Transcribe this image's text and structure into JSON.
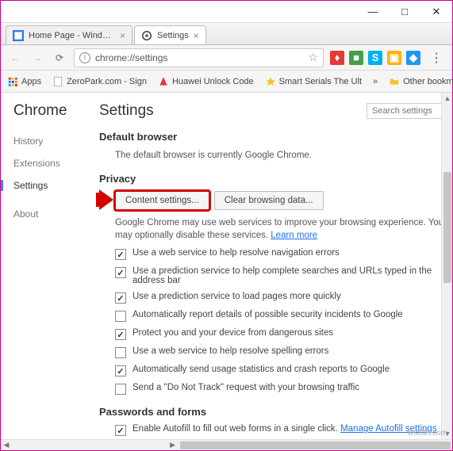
{
  "window": {
    "minimize": "—",
    "maximize": "□",
    "close": "✕"
  },
  "tabs": [
    {
      "label": "Home Page - Windows T",
      "close": "×"
    },
    {
      "label": "Settings",
      "close": "×"
    }
  ],
  "address": {
    "url": "chrome://settings"
  },
  "extensions": [
    "A",
    "B",
    "S",
    "P",
    "E"
  ],
  "bookmarks": {
    "apps": "Apps",
    "zeropark": "ZeroPark.com - Sign",
    "huawei": "Huawei Unlock Code",
    "serials": "Smart Serials The Ult",
    "other": "Other bookmarks"
  },
  "leftnav": {
    "title": "Chrome",
    "history": "History",
    "extensions": "Extensions",
    "settings": "Settings",
    "about": "About"
  },
  "page": {
    "title": "Settings",
    "search_placeholder": "Search settings"
  },
  "default_browser": {
    "heading": "Default browser",
    "text": "The default browser is currently Google Chrome."
  },
  "privacy": {
    "heading": "Privacy",
    "content_btn": "Content settings...",
    "clear_btn": "Clear browsing data...",
    "desc_pre": "Google Chrome may use web services to improve your browsing experience. You may optionally disable these services. ",
    "learn_more": "Learn more",
    "checks": [
      {
        "checked": true,
        "label": "Use a web service to help resolve navigation errors"
      },
      {
        "checked": true,
        "label": "Use a prediction service to help complete searches and URLs typed in the address bar"
      },
      {
        "checked": true,
        "label": "Use a prediction service to load pages more quickly"
      },
      {
        "checked": false,
        "label": "Automatically report details of possible security incidents to Google"
      },
      {
        "checked": true,
        "label": "Protect you and your device from dangerous sites"
      },
      {
        "checked": false,
        "label": "Use a web service to help resolve spelling errors"
      },
      {
        "checked": true,
        "label": "Automatically send usage statistics and crash reports to Google"
      },
      {
        "checked": false,
        "label": "Send a \"Do Not Track\" request with your browsing traffic"
      }
    ]
  },
  "passwords": {
    "heading": "Passwords and forms",
    "check_label": "Enable Autofill to fill out web forms in a single click. ",
    "manage": "Manage Autofill settings"
  },
  "watermark": "wsxdn.com"
}
